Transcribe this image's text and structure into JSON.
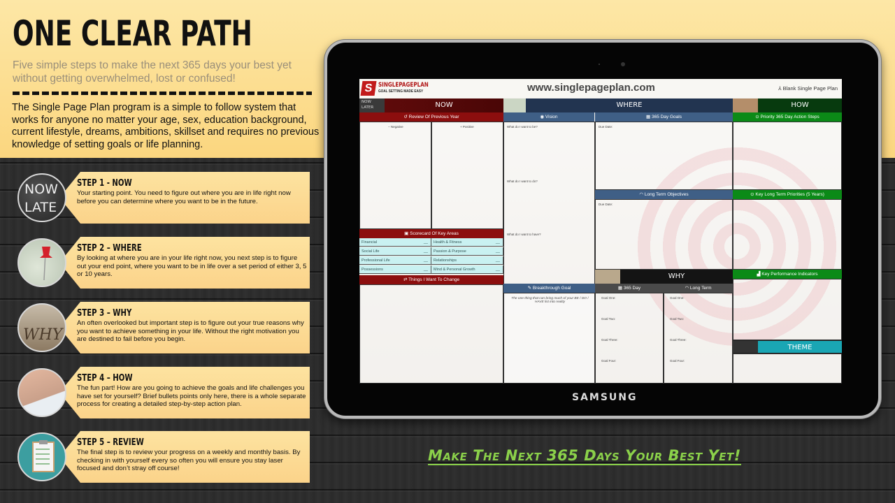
{
  "hero": {
    "title": "ONE CLEAR PATH",
    "subtitle": "Five simple steps to make the next 365 days your best yet without getting overwhelmed, lost or confused!",
    "body": "The Single Page Plan program is a simple to follow system that works for anyone no matter your age, sex, education background, current lifestyle, dreams, ambitions, skillset and requires no previous knowledge of setting goals or life planning."
  },
  "steps": [
    {
      "title": "STEP 1 - NOW",
      "text": "Your starting point. You need to figure out where you are in life right now before you can determine where you want to be in the future.",
      "icon": "now-later-chalkboard-icon"
    },
    {
      "title": "STEP 2 – WHERE",
      "text": "By looking at where you are in your life right now, you next step is to figure out your end point, where you want to be in life over a set period of either 3, 5 or 10 years.",
      "icon": "map-pin-icon"
    },
    {
      "title": "STEP 3 – WHY",
      "text": "An often overlooked but important step is to figure out your true reasons why you want to achieve something in your life. Without the right motivation you are destined to fail before you begin.",
      "icon": "why-sand-icon"
    },
    {
      "title": "STEP 4 – HOW",
      "text": "The fun part! How are you going to achieve the goals and life challenges you have set for yourself? Brief bullets points only here, there is a whole separate process for creating a detailed step-by-step action plan.",
      "icon": "planning-notes-icon"
    },
    {
      "title": "STEP 5 – REVIEW",
      "text": "The final step is to review your progress on a weekly and monthly basis. By checking in with yourself every so often you will ensure you stay laser focused and don’t stray off course!",
      "icon": "clipboard-checklist-icon"
    }
  ],
  "tablet": {
    "brand": "SAMSUNG",
    "screen": {
      "logo_title": "SINGLEPAGEPLAN",
      "logo_tagline": "GOAL SETTING MADE EASY",
      "url": "www.singlepageplan.com",
      "blank_link": "⅄ Blank Single Page Plan",
      "now_later": [
        "NOW",
        "LATER"
      ],
      "bands": {
        "now": "NOW",
        "where": "WHERE",
        "how": "HOW",
        "why": "WHY",
        "theme": "THEME"
      },
      "sections": {
        "review": "↺ Review Of Previous Year",
        "vision": "◉ Vision",
        "goals_365": "▦ 365 Day Goals",
        "priority_365": "⊙ Priority 365 Day Action Steps",
        "long_term_objectives": "◠ Long Term Objectives",
        "key_long_term": "⊙ Key Long Term Priorities (5 Years)",
        "scorecard": "▣ Scorecard Of Key Areas",
        "things_change": "⇄ Things I Want To Change",
        "breakthrough": "✎ Breakthrough Goal",
        "why_365": "▦ 365 Day",
        "why_long": "◠ Long Term",
        "kpi": "▟ Key Performance Indicators"
      },
      "review_cols": [
        "− Negative",
        "+ Positive"
      ],
      "vision_prompts": [
        "What do I want to be?",
        "What do I want to do?",
        "What do I want to have?"
      ],
      "due_date": "Due Date:",
      "scorecard": [
        {
          "label": "Financial",
          "value": "__"
        },
        {
          "label": "Health & Fitness",
          "value": "__"
        },
        {
          "label": "Social Life",
          "value": "__"
        },
        {
          "label": "Passion & Purpose",
          "value": "__"
        },
        {
          "label": "Professional Life",
          "value": "__"
        },
        {
          "label": "Relationships",
          "value": "__"
        },
        {
          "label": "Possessions",
          "value": "__"
        },
        {
          "label": "Mind & Personal Growth",
          "value": "__"
        }
      ],
      "breakthrough_text": "The one thing that can bring much of your BE / DO / HAVE list into reality",
      "why_goals": [
        "Goal One:",
        "Goal Two:",
        "Goal Three:",
        "Goal Four:"
      ]
    }
  },
  "tagline": "Make The Next 365 Days Your Best Yet!"
}
